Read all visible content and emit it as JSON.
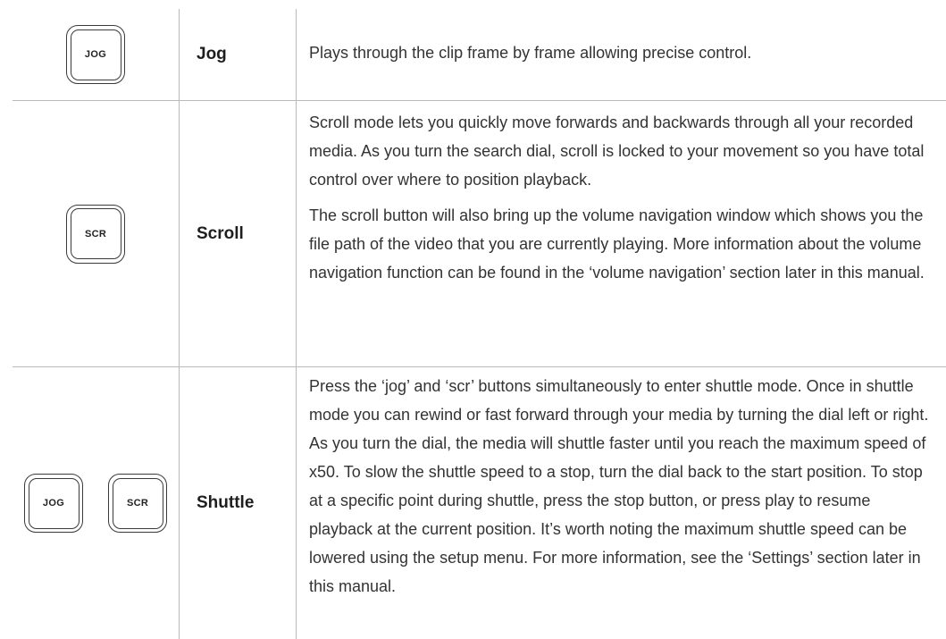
{
  "rows": [
    {
      "keys": [
        "JOG"
      ],
      "name": "Jog",
      "paragraphs": [
        "Plays through the clip frame by frame allowing precise control."
      ]
    },
    {
      "keys": [
        "SCR"
      ],
      "name": "Scroll",
      "paragraphs": [
        "Scroll mode lets you quickly move forwards and backwards through all your recorded media. As you turn the search dial, scroll is locked to your movement so you have total control over where to position playback.",
        "The scroll button will also bring up the volume navigation window which shows you the file path of the video that you are currently playing. More information about the volume navigation function can be found in the ‘volume navigation’ section later in this manual."
      ]
    },
    {
      "keys": [
        "JOG",
        "SCR"
      ],
      "name": "Shuttle",
      "paragraphs": [
        "Press the ‘jog’ and ‘scr’ buttons simultaneously to enter shuttle mode. Once in shuttle mode you can rewind or fast forward through your media by turning the dial left or right. As you turn the dial, the media will shuttle faster until you reach the maximum speed of x50. To slow the shuttle speed to a stop, turn the dial back to the start position. To stop at a specific point during shuttle, press the stop button, or press play to resume playback at the current position. It’s worth noting the maximum shuttle speed can be lowered using the setup menu. For more information, see the ‘Settings’ section later in this manual."
      ]
    }
  ]
}
